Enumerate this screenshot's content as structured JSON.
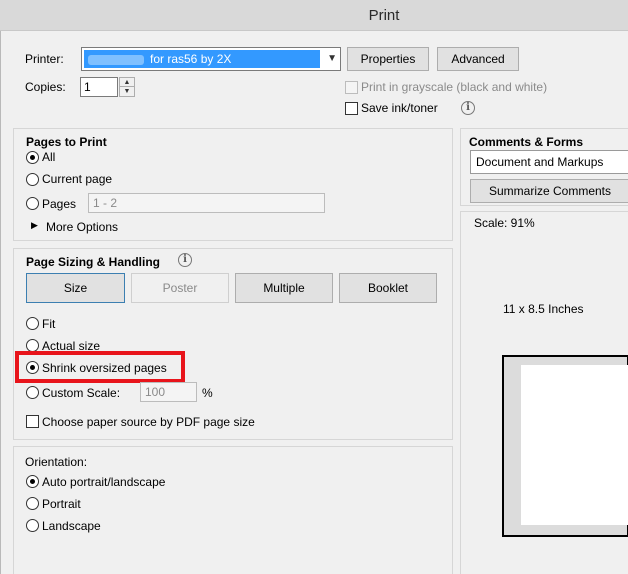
{
  "window": {
    "title": "Print"
  },
  "printer": {
    "label": "Printer:",
    "selected": "for ras56 by 2X",
    "properties_label": "Properties",
    "advanced_label": "Advanced"
  },
  "copies": {
    "label": "Copies:",
    "value": "1"
  },
  "options": {
    "grayscale_label": "Print in grayscale (black and white)",
    "save_ink_label": "Save ink/toner"
  },
  "pages_to_print": {
    "title": "Pages to Print",
    "all_label": "All",
    "current_label": "Current page",
    "pages_label": "Pages",
    "pages_value": "1 - 2",
    "more_options_label": "More Options"
  },
  "page_sizing": {
    "title": "Page Sizing & Handling",
    "size_label": "Size",
    "poster_label": "Poster",
    "multiple_label": "Multiple",
    "booklet_label": "Booklet",
    "fit_label": "Fit",
    "actual_label": "Actual size",
    "shrink_label": "Shrink oversized pages",
    "custom_label": "Custom Scale:",
    "custom_value": "100",
    "percent": "%",
    "paper_source_label": "Choose paper source by PDF page size"
  },
  "orientation": {
    "title": "Orientation:",
    "auto_label": "Auto portrait/landscape",
    "portrait_label": "Portrait",
    "landscape_label": "Landscape"
  },
  "comments_forms": {
    "title": "Comments & Forms",
    "selected": "Document and Markups",
    "summarize_label": "Summarize Comments"
  },
  "preview": {
    "scale_text": "Scale:  91%",
    "size_text": "11 x 8.5 Inches"
  },
  "colors": {
    "highlight": "#e8141b",
    "selection": "#3399ff"
  }
}
